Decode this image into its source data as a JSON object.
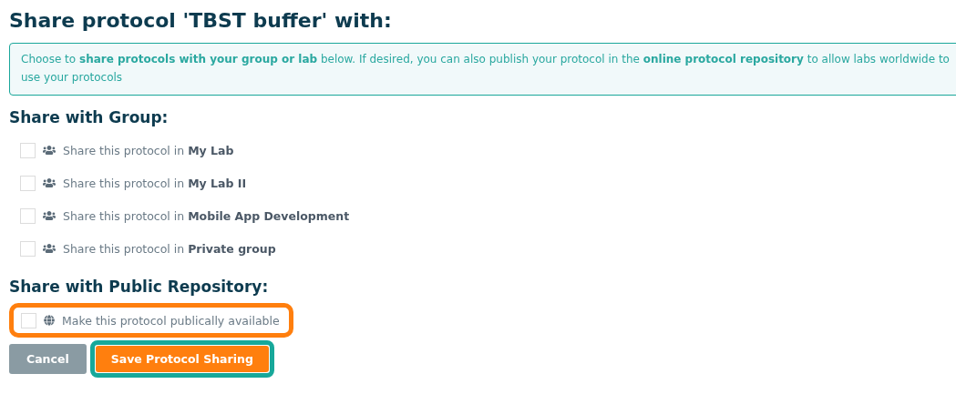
{
  "title": "Share protocol 'TBST buffer' with:",
  "info": "Choose to **share protocols with your group or lab** below. If desired, you can also publish your protocol in the **online protocol repository** to allow labs worldwide to use your protocols",
  "group_section": {
    "heading": "Share with Group:",
    "items": [
      {
        "label": "Share this protocol in **My Lab**",
        "checked": false
      },
      {
        "label": "Share this protocol in **My Lab II**",
        "checked": false
      },
      {
        "label": "Share this protocol in **Mobile App Development**",
        "checked": false
      },
      {
        "label": "Share this protocol in **Private group**",
        "checked": false
      }
    ]
  },
  "public_section": {
    "heading": "Share with Public Repository:",
    "item": {
      "label": "Make this protocol publically available",
      "checked": false,
      "highlighted": true
    }
  },
  "buttons": [
    {
      "kind": "cancel",
      "label": "Cancel",
      "highlighted": false
    },
    {
      "kind": "primary",
      "label": "Save Protocol Sharing",
      "highlighted": true
    }
  ]
}
